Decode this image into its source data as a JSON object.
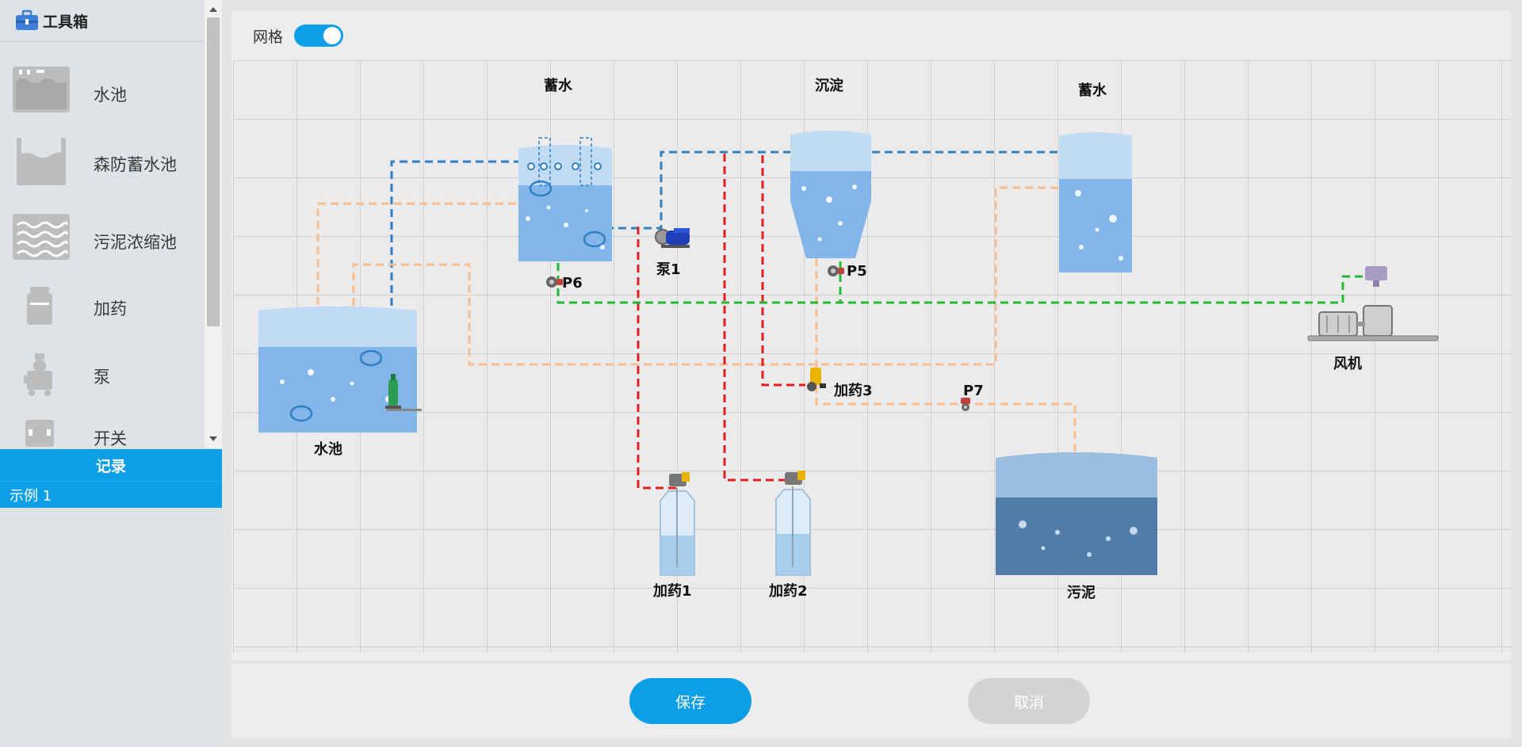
{
  "sidebar": {
    "title": "工具箱",
    "tools": [
      {
        "label": "水池",
        "icon": "pool-icon"
      },
      {
        "label": "森防蓄水池",
        "icon": "reservoir-icon"
      },
      {
        "label": "污泥浓缩池",
        "icon": "sludge-thickener-icon"
      },
      {
        "label": "加药",
        "icon": "dosing-icon"
      },
      {
        "label": "泵",
        "icon": "pump-icon"
      },
      {
        "label": "开关",
        "icon": "switch-icon"
      }
    ],
    "records_title": "记录",
    "records": [
      "示例 1"
    ]
  },
  "toolbar": {
    "grid_label": "网格",
    "grid_enabled": true
  },
  "diagram": {
    "labels": {
      "storage1": "蓄水",
      "sedimentation": "沉淀",
      "storage2": "蓄水",
      "pool": "水池",
      "pump1": "泵1",
      "p6": "P6",
      "p5": "P5",
      "p7": "P7",
      "dosing3": "加药3",
      "dosing1": "加药1",
      "dosing2": "加药2",
      "blower": "风机",
      "sludge": "污泥"
    },
    "colors": {
      "blue_line": "#2f7fc1",
      "orange_line": "#f7bd8e",
      "red_line": "#e02020",
      "green_line": "#22bb33",
      "water_light": "#c2dbf5",
      "water": "#82b6ea",
      "sludge": "#4f7ca9"
    }
  },
  "footer": {
    "save_label": "保存",
    "cancel_label": "取消"
  },
  "colors": {
    "accent": "#0c9ee6",
    "sidebar_bg": "#dde3e6"
  }
}
